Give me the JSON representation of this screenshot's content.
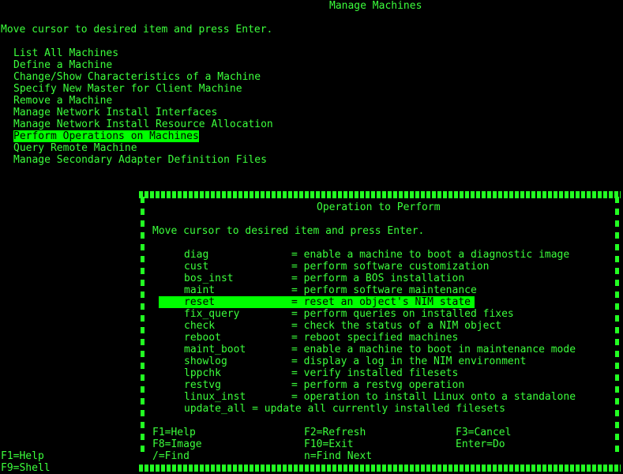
{
  "colors": {
    "foreground": "#3cff3c",
    "background": "#000000",
    "highlight": "#00ff00"
  },
  "screen": {
    "title": "Manage Machines",
    "instruction": "Move cursor to desired item and press Enter.",
    "menu": [
      "List All Machines",
      "Define a Machine",
      "Change/Show Characteristics of a Machine",
      "Specify New Master for Client Machine",
      "Remove a Machine",
      "Manage Network Install Interfaces",
      "Manage Network Install Resource Allocation",
      "Perform Operations on Machines",
      "Query Remote Machine",
      "Manage Secondary Adapter Definition Files"
    ],
    "selected_menu_index": 7,
    "function_keys": [
      "F1=Help",
      "F9=Shell"
    ]
  },
  "popup": {
    "title": "Operation to Perform",
    "instruction": "Move cursor to desired item and press Enter.",
    "operations": [
      {
        "name": "diag",
        "desc": "= enable a machine to boot a diagnostic image"
      },
      {
        "name": "cust",
        "desc": "= perform software customization"
      },
      {
        "name": "bos_inst",
        "desc": "= perform a BOS installation"
      },
      {
        "name": "maint",
        "desc": "= perform software maintenance"
      },
      {
        "name": "reset",
        "desc": "= reset an object's NIM state"
      },
      {
        "name": "fix_query",
        "desc": "= perform queries on installed fixes"
      },
      {
        "name": "check",
        "desc": "= check the status of a NIM object"
      },
      {
        "name": "reboot",
        "desc": "= reboot specified machines"
      },
      {
        "name": "maint_boot",
        "desc": "= enable a machine to boot in maintenance mode"
      },
      {
        "name": "showlog",
        "desc": "= display a log in the NIM environment"
      },
      {
        "name": "lppchk",
        "desc": "= verify installed filesets"
      },
      {
        "name": "restvg",
        "desc": "= perform a restvg operation"
      },
      {
        "name": "linux_inst",
        "desc": "= operation to install Linux onto a standalone"
      }
    ],
    "last_line": "update_all = update all currently installed filesets",
    "selected_operation_index": 4,
    "function_keys": {
      "f1": "F1=Help",
      "f2": "F2=Refresh",
      "f3": "F3=Cancel",
      "f8": "F8=Image",
      "f10": "F10=Exit",
      "enter": "Enter=Do",
      "find": "/=Find",
      "find_next": "n=Find Next"
    }
  }
}
